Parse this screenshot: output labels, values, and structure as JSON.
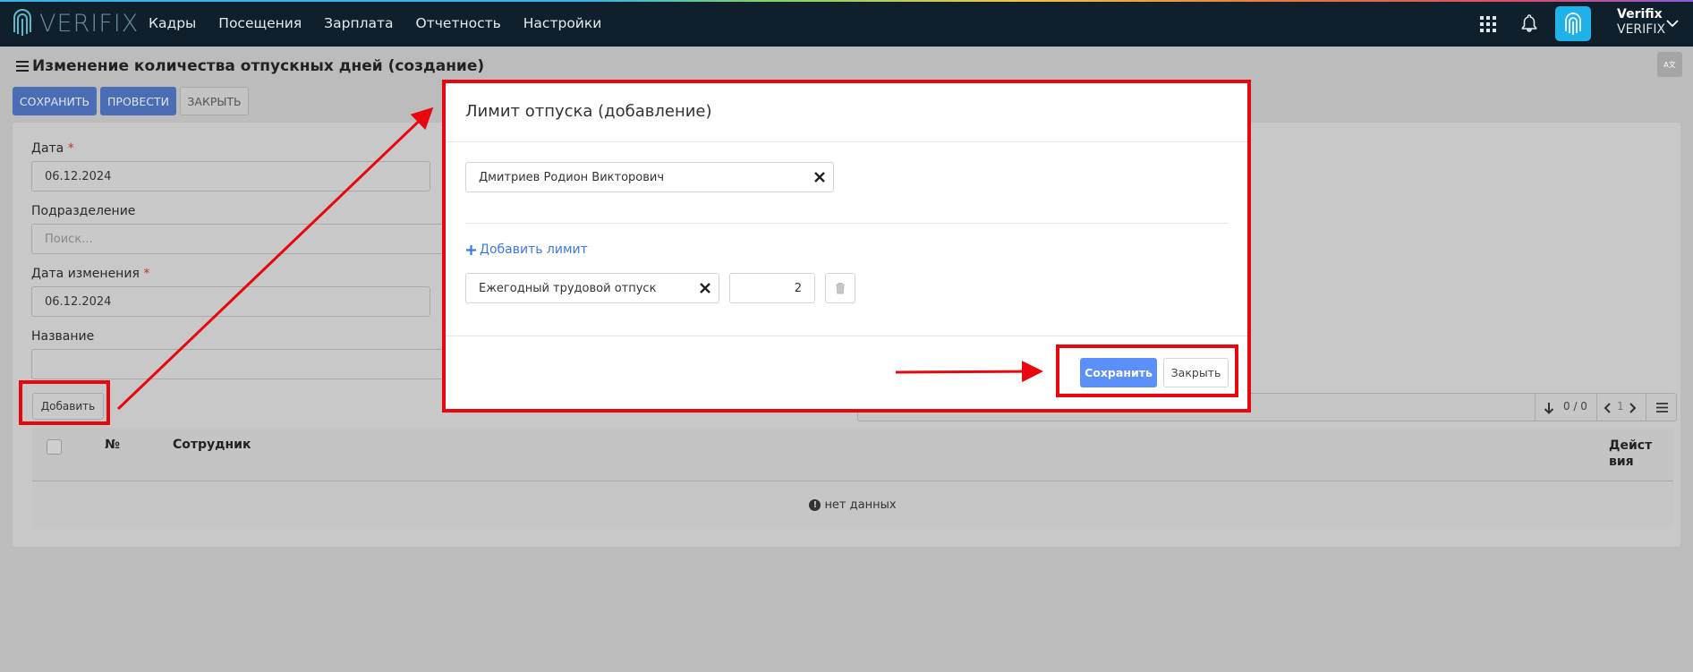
{
  "app": {
    "logo_text": "VERIFIX",
    "nav": [
      "Кадры",
      "Посещения",
      "Зарплата",
      "Отчетность",
      "Настройки"
    ],
    "user_name": "Verifix",
    "user_org": "VERIFIX"
  },
  "page": {
    "title": "Изменение количества отпускных дней (создание)",
    "lang_label": "A文",
    "buttons": {
      "save": "СОХРАНИТЬ",
      "post": "ПРОВЕСТИ",
      "close": "ЗАКРЫТЬ"
    },
    "form": {
      "date_label": "Дата",
      "date_value": "06.12.2024",
      "division_label": "Подразделение",
      "division_placeholder": "Поиск...",
      "change_date_label": "Дата изменения",
      "change_date_value": "06.12.2024",
      "name_label": "Название",
      "name_value": "",
      "required_mark": "*"
    },
    "add_button": "Добавить",
    "table": {
      "pager_count": "0 / 0",
      "page_number": "1",
      "headers": {
        "number": "№",
        "employee": "Сотрудник",
        "actions": "Действия"
      },
      "empty_text": "нет данных"
    }
  },
  "modal": {
    "title": "Лимит отпуска (добавление)",
    "employee": "Дмитриев Родион Викторович",
    "add_limit": "Добавить лимит",
    "limit_type": "Ежегодный трудовой отпуск",
    "limit_days": "2",
    "save": "Сохранить",
    "close": "Закрыть"
  },
  "colors": {
    "navbar": "#0f202c",
    "primary": "#5b8ff9",
    "annotation_red": "#e8060f",
    "link": "#3b78e7"
  }
}
